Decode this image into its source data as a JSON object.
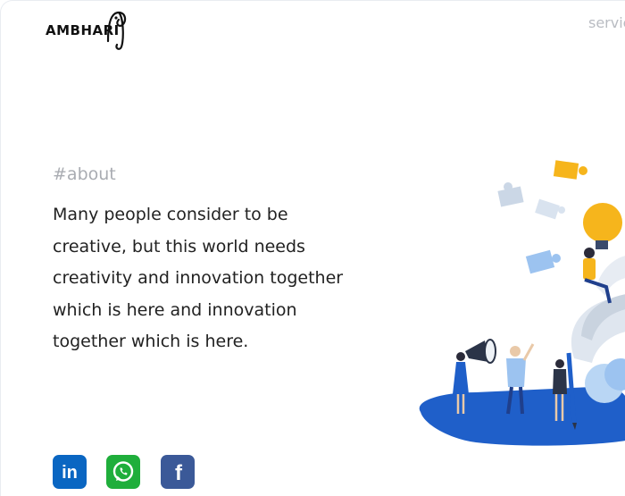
{
  "header": {
    "logo_text": "AMBHARI",
    "nav_link": "servic"
  },
  "about": {
    "tag": "#about",
    "lines": [
      "Many people consider to be",
      "creative, but this world needs",
      "creativity and innovation together",
      "which is here and innovation",
      "together which is here."
    ]
  },
  "social": {
    "items": [
      {
        "name": "linkedin",
        "label": "in",
        "color": "#0a66c2"
      },
      {
        "name": "whatsapp",
        "color": "#1fae3b"
      },
      {
        "name": "facebook",
        "label": "f",
        "color": "#3b5998"
      }
    ]
  },
  "colors": {
    "accent_blue": "#1f5fc9",
    "light_blue": "#9cc3f0",
    "yellow": "#f6b51c",
    "text": "#222222",
    "muted": "#a9acb2"
  }
}
